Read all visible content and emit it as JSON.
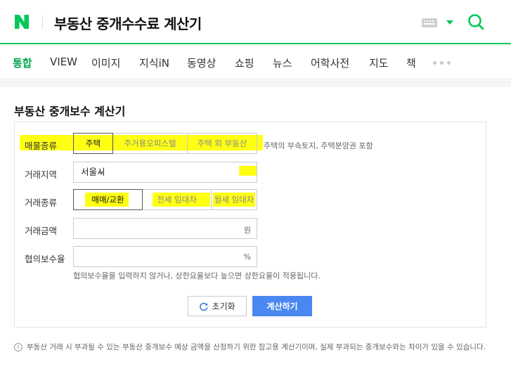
{
  "header": {
    "logo_letter": "N",
    "query": "부동산 중개수수료 계산기",
    "brand_color": "#03c75a"
  },
  "tabs": [
    {
      "label": "통합",
      "active": true
    },
    {
      "label": "VIEW"
    },
    {
      "label": "이미지"
    },
    {
      "label": "지식iN"
    },
    {
      "label": "동영상"
    },
    {
      "label": "쇼핑"
    },
    {
      "label": "뉴스"
    },
    {
      "label": "어학사전"
    },
    {
      "label": "지도"
    },
    {
      "label": "책"
    }
  ],
  "calculator": {
    "title": "부동산 중개보수 계산기",
    "property_type": {
      "label": "매물종류",
      "options": [
        "주택",
        "주거용오피스텔",
        "주택 외 부동산"
      ],
      "selected": "주택",
      "hint": "주택의 부속토지, 주택분양권 포함"
    },
    "region": {
      "label": "거래지역",
      "value": "서울시"
    },
    "deal_type": {
      "label": "거래종류",
      "options": [
        "매매/교환",
        "전세 임대차",
        "월세 임대차"
      ],
      "selected": "매매/교환"
    },
    "amount": {
      "label": "거래금액",
      "value": "",
      "unit": "원"
    },
    "rate": {
      "label": "협의보수율",
      "value": "",
      "unit": "%",
      "note": "협의보수율을 입력하지 않거나, 상한요율보다 높으면 상한요율이 적용됩니다."
    },
    "reset_label": "초기화",
    "calc_label": "계산하기",
    "calc_color": "#4a87f0"
  },
  "footer_note": "부동산 거래 시 부과될 수 있는 부동산 중개보수 예상 금액을 산정하기 위한 참고용 계산기이며, 실제 부과되는 중개보수와는 차이가 있을 수 있습니다.",
  "highlight_color": "#ffff00"
}
